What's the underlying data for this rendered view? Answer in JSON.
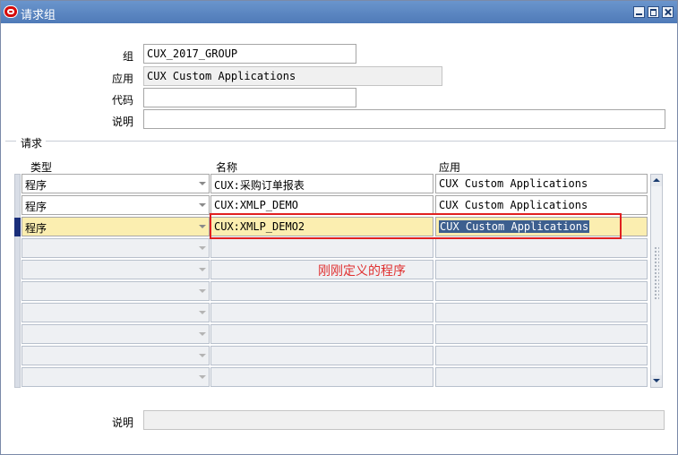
{
  "window": {
    "title": "请求组",
    "controls": [
      "minimize",
      "maximize",
      "close"
    ]
  },
  "header_fields": {
    "group": {
      "label": "组",
      "value": "CUX_2017_GROUP"
    },
    "application": {
      "label": "应用",
      "value": "CUX Custom Applications"
    },
    "code": {
      "label": "代码",
      "value": ""
    },
    "description": {
      "label": "说明",
      "value": ""
    }
  },
  "requests": {
    "section_label": "请求",
    "columns": {
      "type": "类型",
      "name": "名称",
      "application": "应用"
    },
    "rows": [
      {
        "type": "程序",
        "name": "CUX:采购订单报表",
        "application": "CUX Custom Applications"
      },
      {
        "type": "程序",
        "name": "CUX:XMLP_DEMO",
        "application": "CUX Custom Applications"
      },
      {
        "type": "程序",
        "name": "CUX:XMLP_DEMO2",
        "application": "CUX Custom Applications"
      },
      {
        "type": "",
        "name": "",
        "application": ""
      },
      {
        "type": "",
        "name": "",
        "application": ""
      },
      {
        "type": "",
        "name": "",
        "application": ""
      },
      {
        "type": "",
        "name": "",
        "application": ""
      },
      {
        "type": "",
        "name": "",
        "application": ""
      },
      {
        "type": "",
        "name": "",
        "application": ""
      },
      {
        "type": "",
        "name": "",
        "application": ""
      }
    ],
    "current_row": 3
  },
  "annotation": {
    "text": "刚刚定义的程序",
    "color": "#e03030"
  },
  "footer": {
    "description_label": "说明",
    "description_value": ""
  },
  "colors": {
    "titlebar": "#5583c0",
    "current_row_bg": "#fbeeb0",
    "selection_bg": "#3d5f8f",
    "highlight_border": "#e02020"
  }
}
